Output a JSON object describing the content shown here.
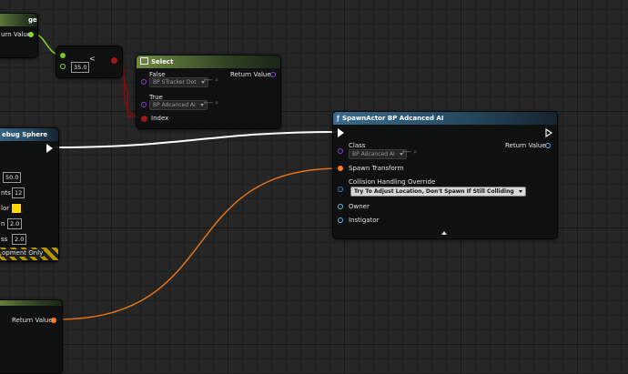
{
  "nodes": {
    "top_left": {
      "title_partial": "ge",
      "return_label": "urn Value"
    },
    "compare": {
      "value": "35.0",
      "op_symbol": "<"
    },
    "select": {
      "title": "Select",
      "false_label": "False",
      "false_value": "BP STracker Dot",
      "true_label": "True",
      "true_value": "BP Adcanced AI",
      "index_label": "Index",
      "return_label": "Return Value"
    },
    "debug_sphere": {
      "title_partial": "ebug Sphere",
      "rows": [
        {
          "label": "",
          "value": "50.0"
        },
        {
          "label": "nts",
          "value": "12"
        },
        {
          "label": "lor",
          "value": ""
        },
        {
          "label": "n",
          "value": "2.0"
        },
        {
          "label": "ss",
          "value": "2.0"
        }
      ],
      "footer": "opment Only"
    },
    "spawn_actor": {
      "title": "SpawnActor BP Adcanced AI",
      "class_label": "Class",
      "class_value": "BP Adcanced AI",
      "return_label": "Return Value",
      "spawn_transform_label": "Spawn Transform",
      "collision_label": "Collision Handling Override",
      "collision_value": "Try To Adjust Location, Don't Spawn If Still Colliding",
      "owner_label": "Owner",
      "instigator_label": "Instigator"
    },
    "bottom_left": {
      "return_label": "Return Value"
    }
  },
  "colors": {
    "exec": "#ffffff",
    "float": "#8cd62a",
    "bool": "#9c1717",
    "class": "#8a3ed6",
    "struct": "#ff7e1b",
    "object": "#5cb6ee",
    "debug_color": "#ffd800"
  },
  "icons": [
    "function-icon",
    "select-icon",
    "exec-pin-icon",
    "dropdown-arrow-icon",
    "browse-icon",
    "expand-arrow-icon"
  ]
}
